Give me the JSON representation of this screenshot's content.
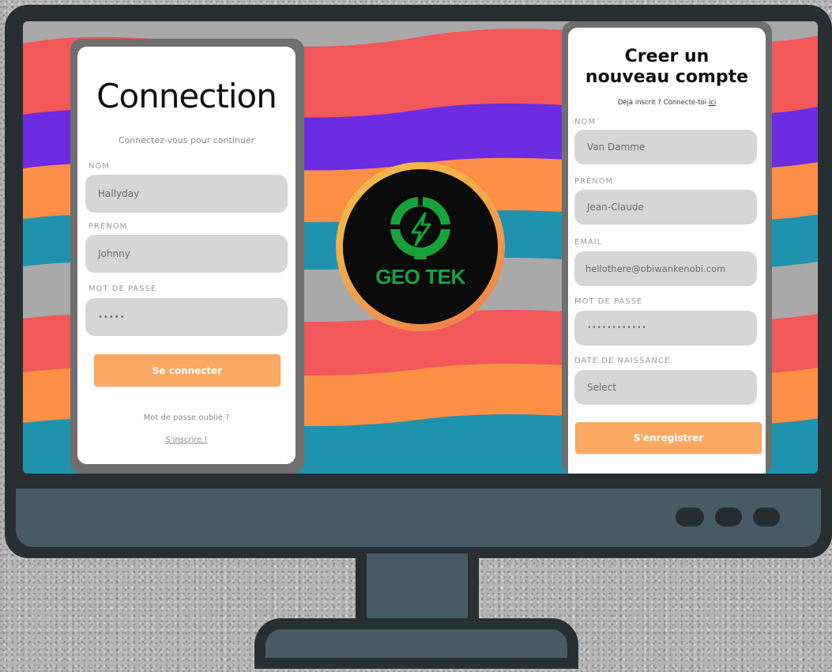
{
  "login": {
    "title": "Connection",
    "subtitle": "Connectez-vous pour continuer",
    "fields": [
      {
        "label": "NOM",
        "value": "Hallyday"
      },
      {
        "label": "PRÉNOM",
        "value": "Johnny"
      },
      {
        "label": "MOT DE PASSE",
        "value": "•••••"
      }
    ],
    "submit_label": "Se connecter",
    "forgot_label": "Mot de passe oublié ?",
    "register_link": "S'inscrire !"
  },
  "logo": {
    "text": "GEO TEK"
  },
  "signup": {
    "title_line1": "Creer un",
    "title_line2": "nouveau compte",
    "already_text": "Déjà inscrit ? Connecte-toi",
    "already_link": "ici",
    "fields": [
      {
        "label": "NOM",
        "value": "Van Damme"
      },
      {
        "label": "PRÉNOM",
        "value": "Jean-Claude"
      },
      {
        "label": "EMAIL",
        "value": "hellothere@obiwankenobi.com"
      },
      {
        "label": "MOT DE PASSE",
        "value": "••••••••••••"
      },
      {
        "label": "DATE DE NAISSANCE",
        "value": "Select"
      }
    ],
    "submit_label": "S'enregistrer"
  },
  "colors": {
    "accent_button": "#fba862",
    "logo_green": "#17a33c",
    "monitor_dark": "#272f33",
    "monitor_slate": "#485a63"
  }
}
